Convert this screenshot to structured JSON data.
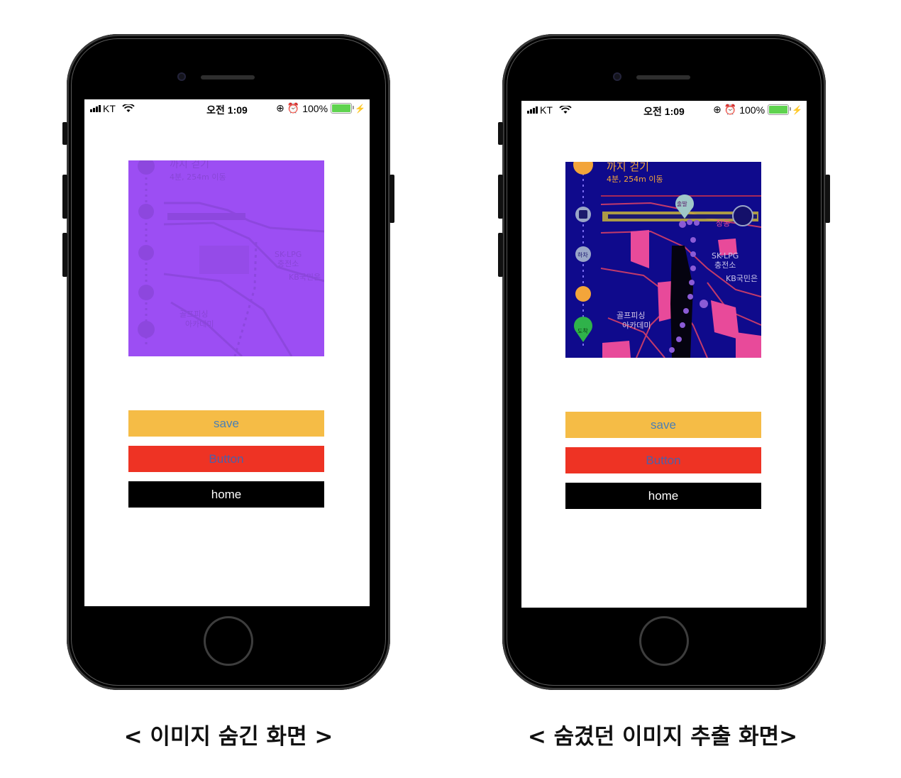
{
  "colors": {
    "save_bg": "#f5bc46",
    "save_text": "#4a7fb5",
    "red_bg": "#ee3324",
    "red_text": "#4e5fa8",
    "home_bg": "#000000",
    "home_text": "#ffffff",
    "hidden_image_bg": "#9c4ef3",
    "extracted_image_bg": "#0f0a8c",
    "battery": "#5fd34f"
  },
  "left_phone": {
    "status_bar": {
      "carrier": "KT",
      "time": "오전 1:09",
      "battery": "100%",
      "icons": [
        "signal-icon",
        "wifi-icon",
        "orientation-lock-icon",
        "alarm-icon",
        "battery-icon",
        "charging-icon"
      ]
    },
    "image": {
      "description_icon": "hidden-map-image",
      "texts": [
        "까지 걷기",
        "4분, 254m 이동",
        "SK-LPG",
        "충전소",
        "KB국민은",
        "골프피싱",
        "아카데미"
      ]
    },
    "buttons": {
      "save": "save",
      "button": "Button",
      "home": "home"
    }
  },
  "right_phone": {
    "status_bar": {
      "carrier": "KT",
      "time": "오전 1:09",
      "battery": "100%",
      "icons": [
        "signal-icon",
        "wifi-icon",
        "orientation-lock-icon",
        "alarm-icon",
        "battery-icon",
        "charging-icon"
      ]
    },
    "image": {
      "description_icon": "extracted-map-image",
      "texts": [
        "까지 걷기",
        "4분, 254m 이동",
        "출발",
        "하차",
        "도착",
        "SK-LPG",
        "충전소",
        "KB국민은",
        "골프피싱",
        "아카데미",
        "창동"
      ]
    },
    "buttons": {
      "save": "save",
      "button": "Button",
      "home": "home"
    }
  },
  "captions": {
    "left": "< 이미지 숨긴 화면 >",
    "right": "< 숨겼던 이미지 추출 화면>"
  }
}
